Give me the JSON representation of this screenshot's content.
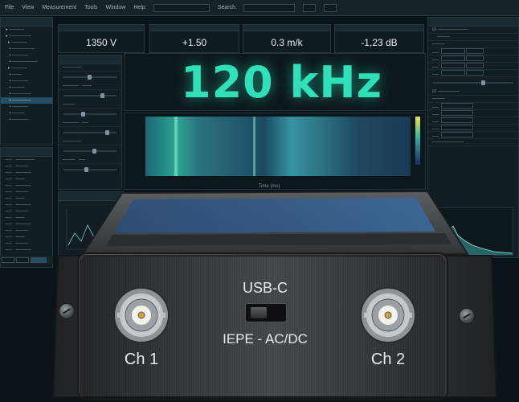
{
  "menubar": {
    "items": [
      "File",
      "View",
      "Measurement",
      "Tools",
      "Window",
      "Help"
    ],
    "search_label": "Search",
    "field_value": ""
  },
  "readouts": [
    {
      "value": "1350 V"
    },
    {
      "value": "+1.50"
    },
    {
      "value": "0.3 m/k"
    },
    {
      "value": "-1,23 dB"
    }
  ],
  "main_display": {
    "frequency": "120 kHz"
  },
  "spectrogram": {
    "xlabel": "Time (ms)"
  },
  "device": {
    "port_label": "USB-C",
    "mode_label": "IEPE - AC/DC",
    "ch1_label": "Ch 1",
    "ch2_label": "Ch 2"
  },
  "colors": {
    "accent": "#2fe0b8",
    "selection": "#244e66"
  }
}
